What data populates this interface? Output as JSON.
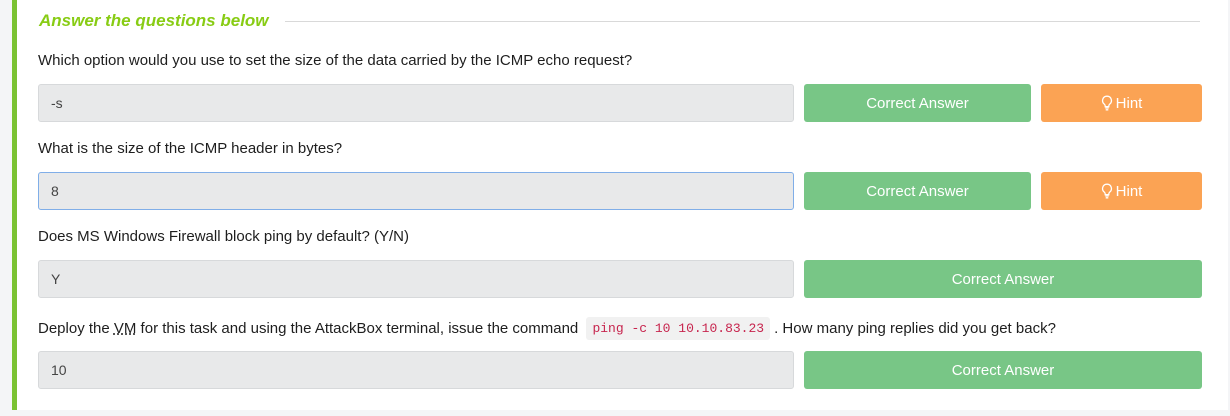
{
  "section": {
    "title": "Answer the questions below"
  },
  "questions": [
    {
      "text": "Which option would you use to set the size of the data carried by the ICMP echo request?",
      "answer": "-s",
      "button": "Correct Answer",
      "hint": "Hint"
    },
    {
      "text": "What is the size of the ICMP header in bytes?",
      "answer": "8",
      "button": "Correct Answer",
      "hint": "Hint"
    },
    {
      "text": "Does MS Windows Firewall block ping by default? (Y/N)",
      "answer": "Y",
      "button": "Correct Answer"
    },
    {
      "text_before": "Deploy the ",
      "text_abbr": "VM",
      "text_middle": " for this task and using the AttackBox terminal, issue the command ",
      "code": "ping -c 10 10.10.83.23",
      "text_after": ". How many ping replies did you get back?",
      "answer": "10",
      "button": "Correct Answer"
    }
  ],
  "colors": {
    "accent": "#88cc14",
    "success": "#78c686",
    "hint": "#fba354",
    "code": "#c7254e"
  },
  "icons": {
    "hint": "lightbulb-icon"
  }
}
